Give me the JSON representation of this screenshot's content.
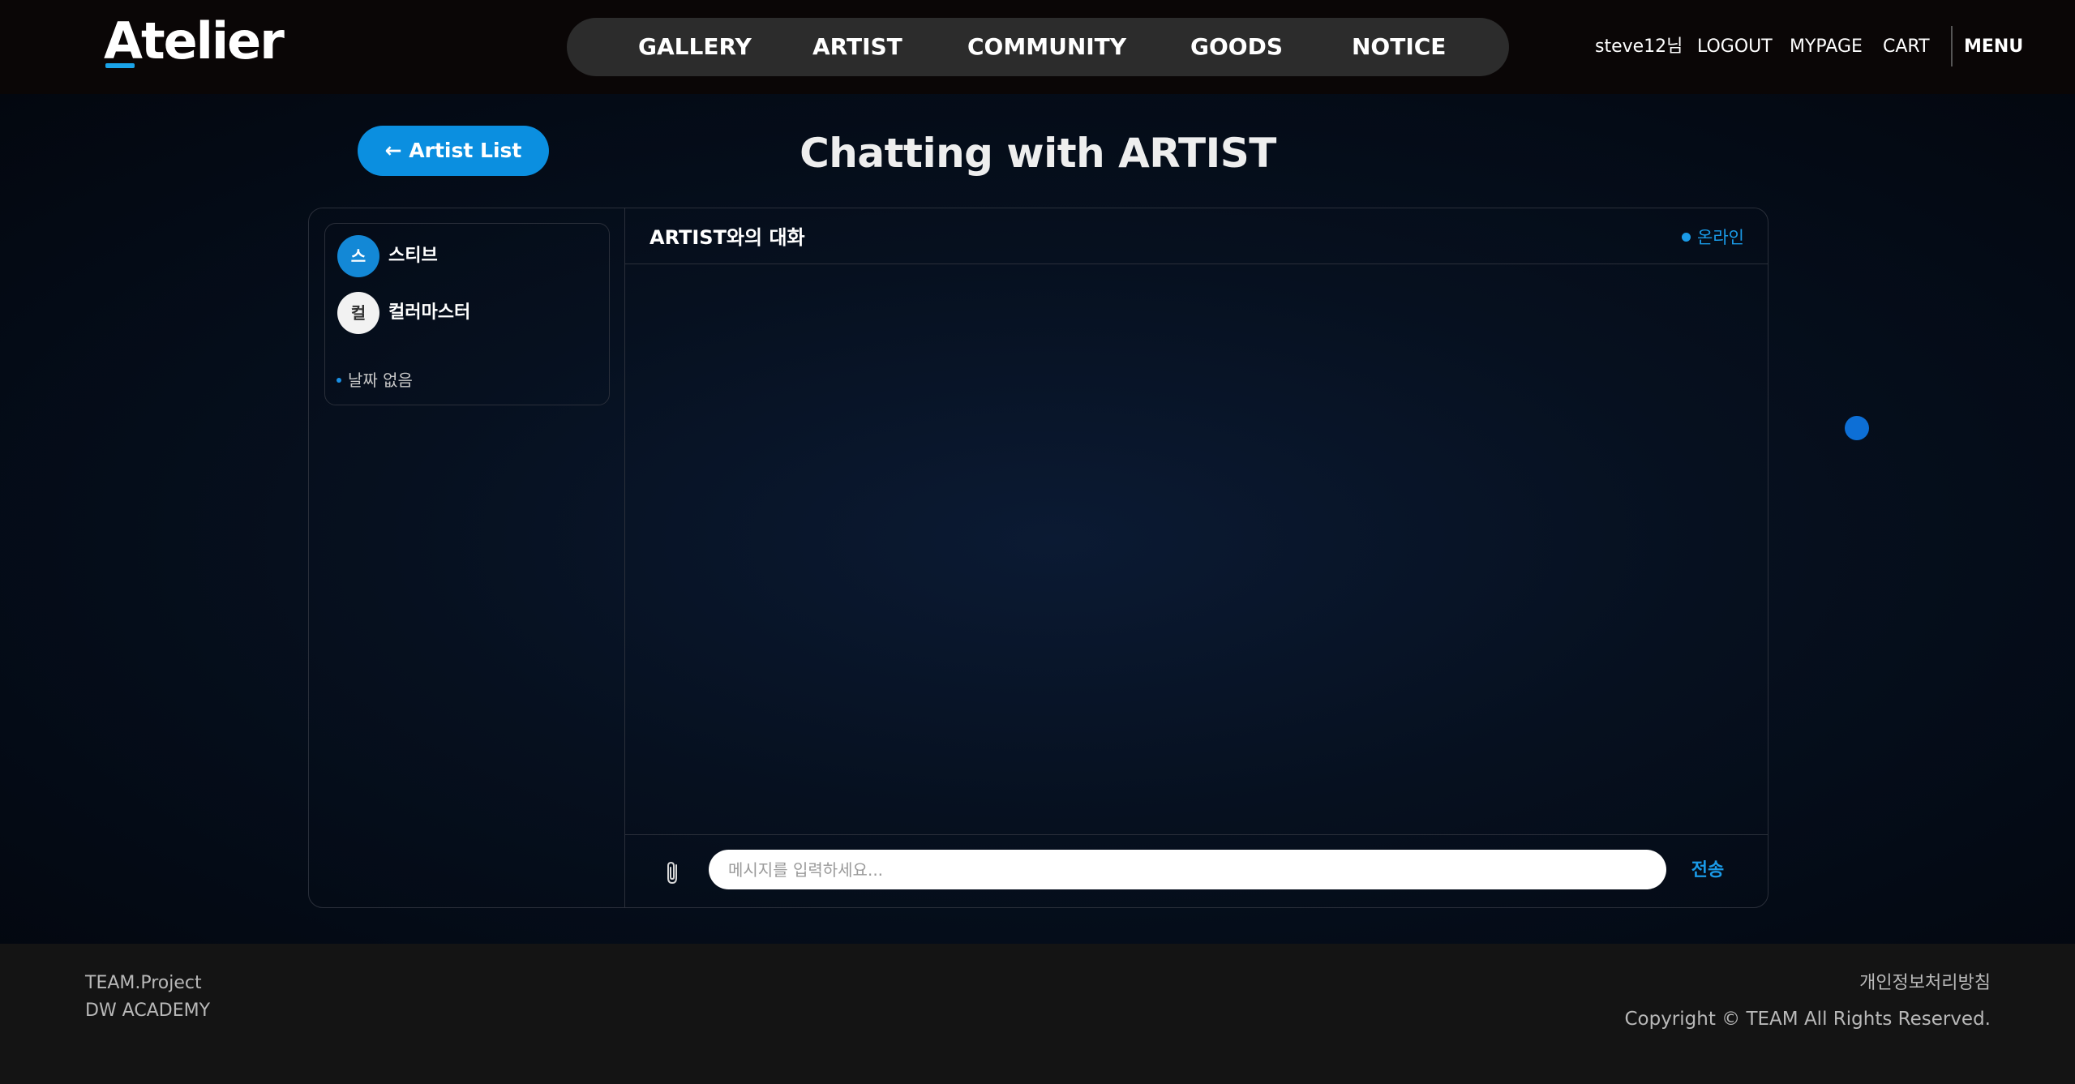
{
  "header": {
    "logo_text": "Atelier",
    "nav": [
      "GALLERY",
      "ARTIST",
      "COMMUNITY",
      "GOODS",
      "NOTICE"
    ],
    "user_greeting": "steve12님",
    "logout": "LOGOUT",
    "mypage": "MYPAGE",
    "cart": "CART",
    "menu": "MENU"
  },
  "main": {
    "back_button": "← Artist List",
    "title": "Chatting with ARTIST"
  },
  "sidebar": {
    "users": [
      {
        "initial": "스",
        "name": "스티브"
      },
      {
        "initial": "컬",
        "name": "컬러마스터"
      }
    ],
    "date_text": "날짜 없음"
  },
  "chat": {
    "title": "ARTIST와의 대화",
    "status": "온라인",
    "input_placeholder": "메시지를 입력하세요...",
    "send_label": "전송"
  },
  "footer": {
    "team": "TEAM.Project",
    "academy": "DW ACADEMY",
    "privacy": "개인정보처리방침",
    "copyright": "Copyright © TEAM All Rights Reserved."
  },
  "colors": {
    "accent": "#0b8fe0",
    "online": "#1a9be8",
    "header_bg": "#0a0606",
    "footer_bg": "#141414"
  },
  "icons": {
    "attach": "paperclip-icon",
    "status": "online-dot-icon"
  }
}
